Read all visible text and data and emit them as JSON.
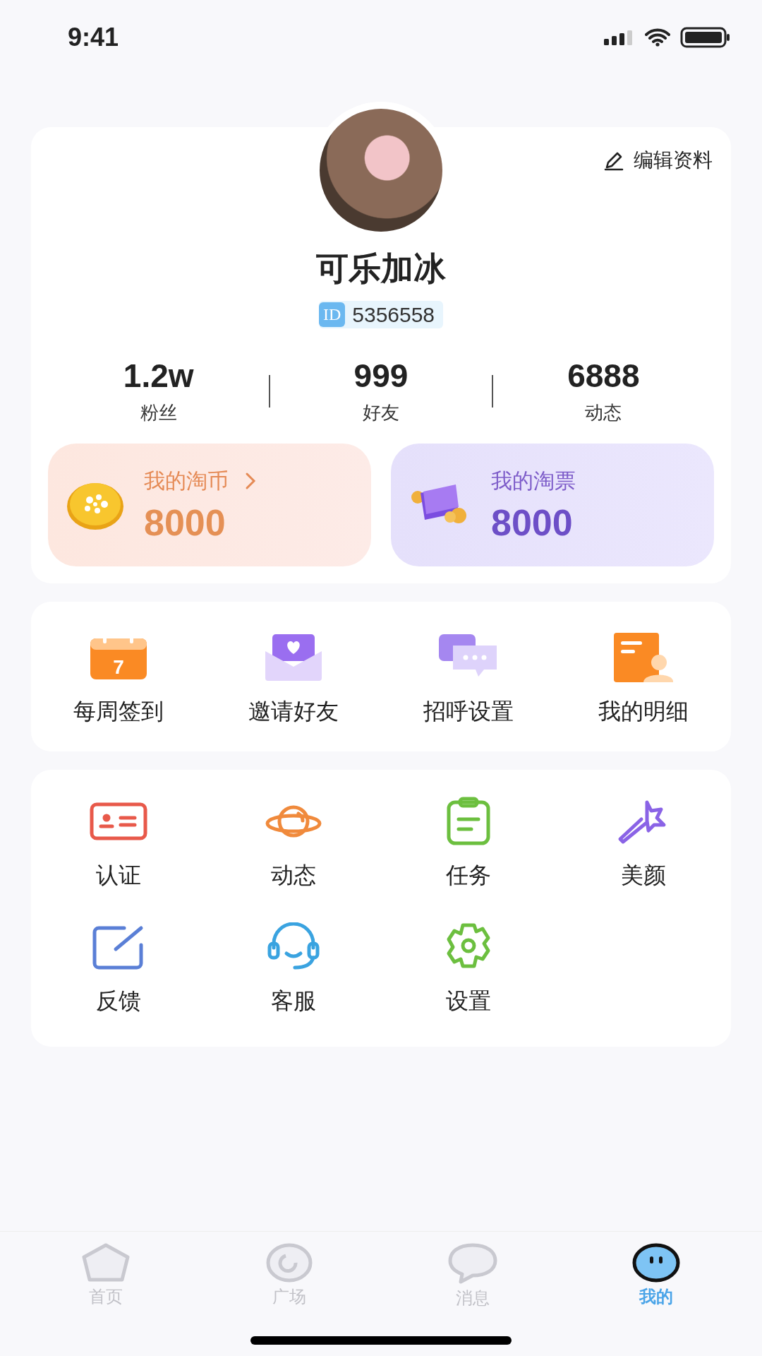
{
  "status_bar": {
    "time": "9:41"
  },
  "profile": {
    "edit_label": "编辑资料",
    "name": "可乐加冰",
    "id_badge": "ID",
    "id": "5356558",
    "stats": [
      {
        "value": "1.2w",
        "label": "粉丝"
      },
      {
        "value": "999",
        "label": "好友"
      },
      {
        "value": "6888",
        "label": "动态"
      }
    ]
  },
  "wallet": [
    {
      "kind": "coin",
      "label": "我的淘币",
      "amount": "8000",
      "arrow": true
    },
    {
      "kind": "ticket",
      "label": "我的淘票",
      "amount": "8000",
      "arrow": false
    }
  ],
  "quick_actions": [
    {
      "label": "每周签到",
      "day": "7"
    },
    {
      "label": "邀请好友"
    },
    {
      "label": "招呼设置"
    },
    {
      "label": "我的明细"
    }
  ],
  "tools": [
    {
      "label": "认证",
      "color": "#e8594a"
    },
    {
      "label": "动态",
      "color": "#f08a3c"
    },
    {
      "label": "任务",
      "color": "#6cbf3f"
    },
    {
      "label": "美颜",
      "color": "#8a63e6"
    },
    {
      "label": "反馈",
      "color": "#5a7fd6"
    },
    {
      "label": "客服",
      "color": "#3aa3e0"
    },
    {
      "label": "设置",
      "color": "#6cbf3f"
    }
  ],
  "tab_bar": [
    {
      "label": "首页",
      "selected": false
    },
    {
      "label": "广场",
      "selected": false
    },
    {
      "label": "消息",
      "selected": false
    },
    {
      "label": "我的",
      "selected": true
    }
  ]
}
